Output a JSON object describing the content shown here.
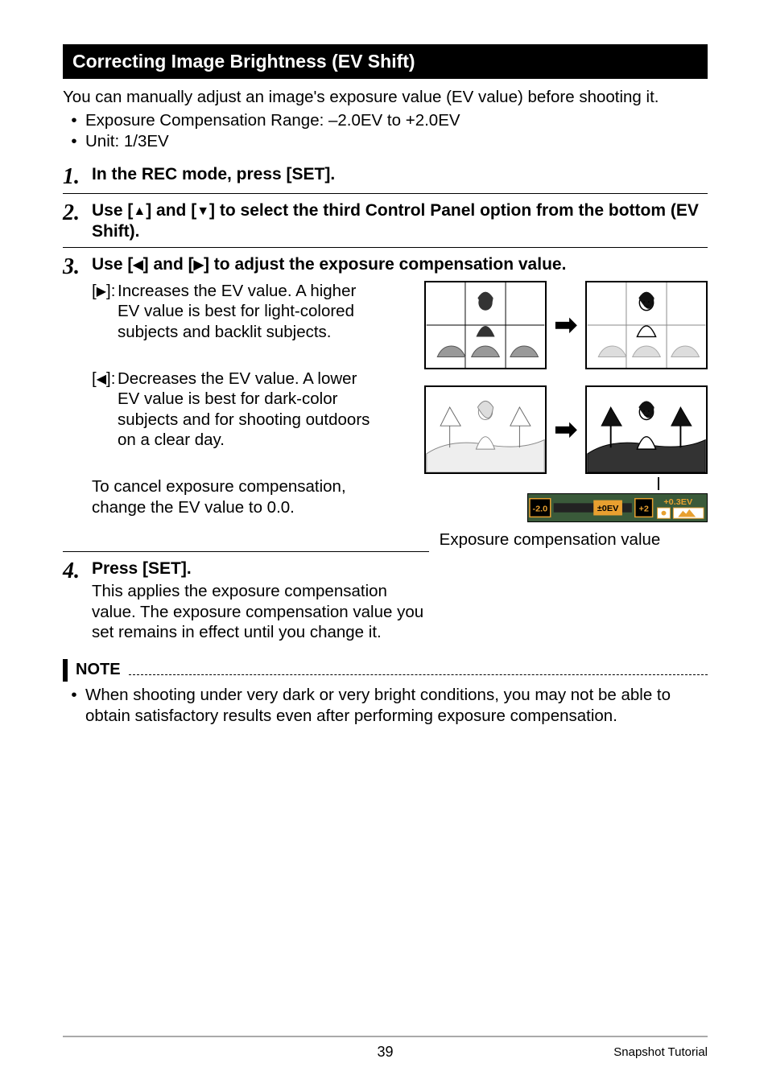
{
  "sectionTitle": "Correcting Image Brightness (EV Shift)",
  "intro": "You can manually adjust an image's exposure value (EV value) before shooting it.",
  "bullet1": "Exposure Compensation Range: –2.0EV to +2.0EV",
  "bullet2": "Unit: 1/3EV",
  "step1": {
    "num": "1.",
    "title": "In the REC mode, press [SET]."
  },
  "step2": {
    "num": "2.",
    "titleA": "Use [",
    "titleB": "] and [",
    "titleC": "] to select the third Control Panel option from the bottom (EV Shift)."
  },
  "step3": {
    "num": "3.",
    "titleA": "Use [",
    "titleB": "] and [",
    "titleC": "] to adjust the exposure compensation value.",
    "incLabelA": "[",
    "incLabelB": "]:",
    "incText": "Increases the EV value. A higher EV value is best for light-colored subjects and backlit subjects.",
    "decLabelA": "[",
    "decLabelB": "]:",
    "decText": "Decreases the EV value. A lower EV value is best for dark-color subjects and for shooting outdoors on a clear day.",
    "cancelText": "To cancel exposure compensation, change the EV value to 0.0.",
    "evCaption": "Exposure compensation value",
    "evBar": {
      "min": "-2.0",
      "zero": "±0EV",
      "max": "+2",
      "current": "+0.3EV"
    }
  },
  "step4": {
    "num": "4.",
    "title": "Press [SET].",
    "body": "This applies the exposure compensation value. The exposure compensation value you set remains in effect until you change it."
  },
  "note": {
    "label": "NOTE",
    "text": "When shooting under very dark or very bright conditions, you may not be able to obtain satisfactory results even after performing exposure compensation."
  },
  "footer": {
    "page": "39",
    "section": "Snapshot Tutorial"
  }
}
